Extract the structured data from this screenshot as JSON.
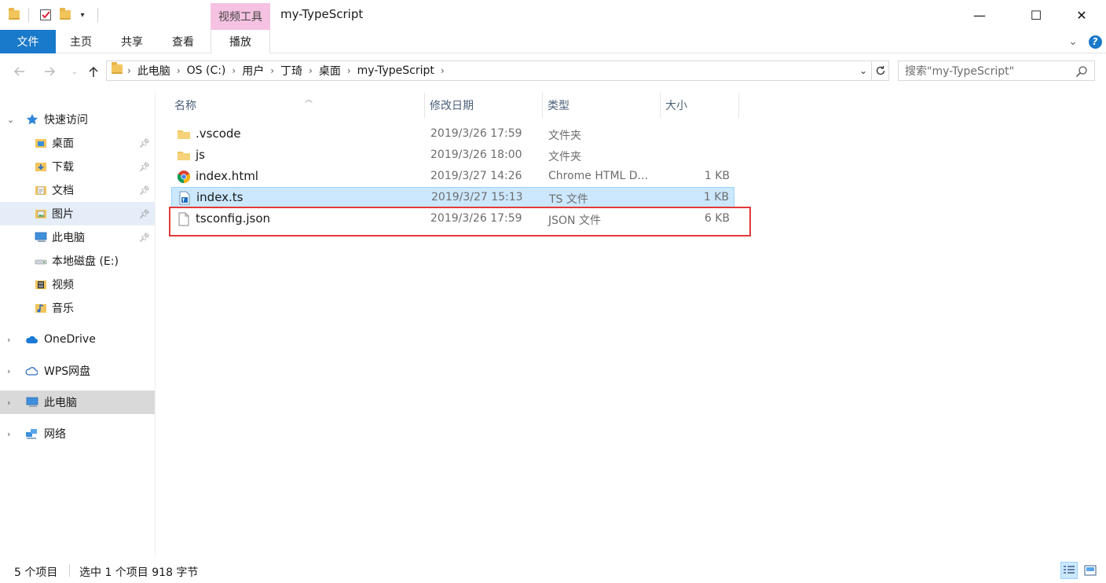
{
  "window": {
    "contextual_tab": "视频工具",
    "title": "my-TypeScript",
    "minimize": "—",
    "maximize": "☐",
    "close": "✕"
  },
  "ribbon": {
    "tabs": [
      {
        "label": "文件"
      },
      {
        "label": "主页"
      },
      {
        "label": "共享"
      },
      {
        "label": "查看"
      },
      {
        "label": "播放"
      }
    ]
  },
  "address": {
    "crumbs": [
      "此电脑",
      "OS (C:)",
      "用户",
      "丁琦",
      "桌面",
      "my-TypeScript"
    ],
    "search_placeholder": "搜索\"my-TypeScript\""
  },
  "nav": {
    "quick_access": "快速访问",
    "items": [
      {
        "label": "桌面",
        "icon": "desktop-folder-icon",
        "pinned": true
      },
      {
        "label": "下载",
        "icon": "download-folder-icon",
        "pinned": true
      },
      {
        "label": "文档",
        "icon": "documents-folder-icon",
        "pinned": true
      },
      {
        "label": "图片",
        "icon": "pictures-folder-icon",
        "pinned": true
      },
      {
        "label": "此电脑",
        "icon": "computer-icon",
        "pinned": true
      },
      {
        "label": "本地磁盘 (E:)",
        "icon": "drive-icon",
        "pinned": false
      },
      {
        "label": "视频",
        "icon": "videos-folder-icon",
        "pinned": false
      },
      {
        "label": "音乐",
        "icon": "music-folder-icon",
        "pinned": false
      }
    ],
    "onedrive": "OneDrive",
    "wps": "WPS网盘",
    "thispc": "此电脑",
    "network": "网络"
  },
  "columns": {
    "name": "名称",
    "date": "修改日期",
    "type": "类型",
    "size": "大小"
  },
  "files": [
    {
      "name": ".vscode",
      "date": "2019/3/26 17:59",
      "type": "文件夹",
      "size": "",
      "icon": "folder-icon"
    },
    {
      "name": "js",
      "date": "2019/3/26 18:00",
      "type": "文件夹",
      "size": "",
      "icon": "folder-icon"
    },
    {
      "name": "index.html",
      "date": "2019/3/27 14:26",
      "type": "Chrome HTML D...",
      "size": "1 KB",
      "icon": "chrome-icon"
    },
    {
      "name": "index.ts",
      "date": "2019/3/27 15:13",
      "type": "TS 文件",
      "size": "1 KB",
      "icon": "ts-file-icon"
    },
    {
      "name": "tsconfig.json",
      "date": "2019/3/26 17:59",
      "type": "JSON 文件",
      "size": "6 KB",
      "icon": "file-icon"
    }
  ],
  "status": {
    "count": "5 个项目",
    "selection": "选中 1 个项目  918 字节"
  },
  "colors": {
    "accent": "#1979ca",
    "selection": "#cce8ff",
    "highlight": "#e23a3a"
  }
}
